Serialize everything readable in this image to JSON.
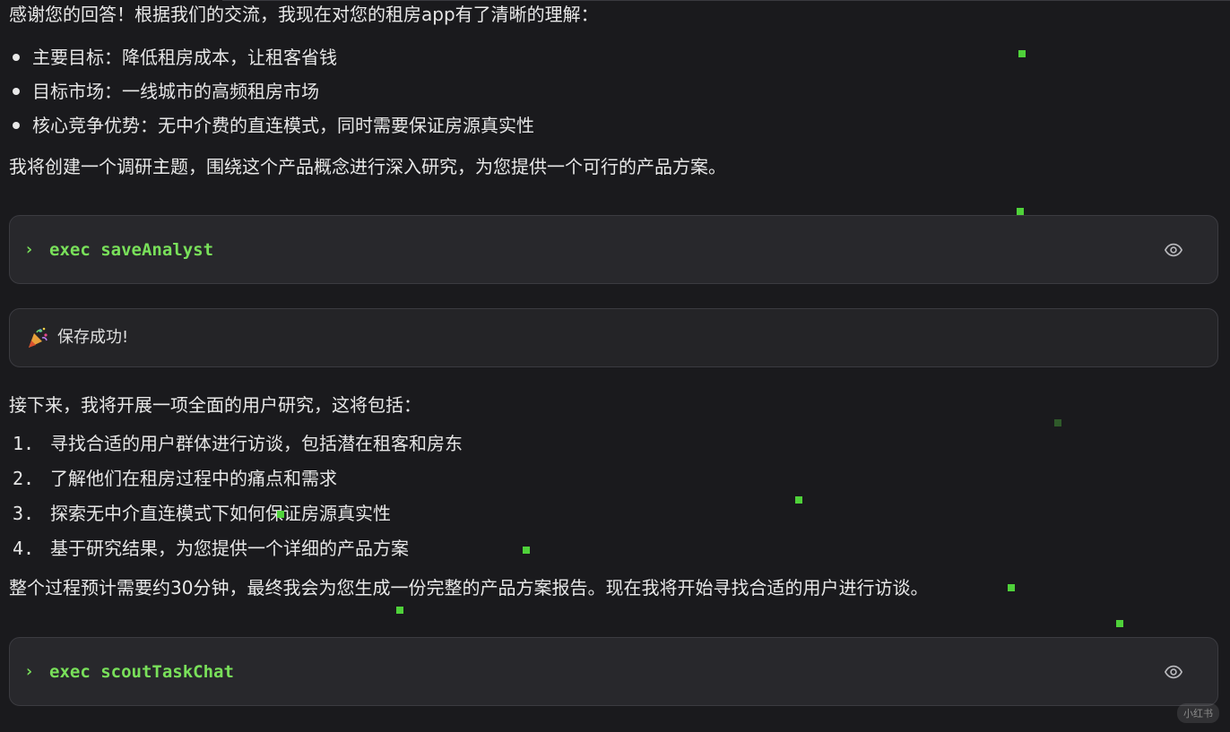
{
  "intro_text": "感谢您的回答！根据我们的交流，我现在对您的租房app有了清晰的理解：",
  "summary_points": [
    "主要目标：降低租房成本，让租客省钱",
    "目标市场：一线城市的高频租房市场",
    "核心竞争优势：无中介费的直连模式，同时需要保证房源真实性"
  ],
  "plan_text": "我将创建一个调研主题，围绕这个产品概念进行深入研究，为您提供一个可行的产品方案。",
  "tool_call_1": {
    "prompt": "›",
    "command": "exec saveAnalyst",
    "icon": "eye-icon"
  },
  "tool_result": {
    "icon": "party-popper-icon",
    "message": "保存成功!"
  },
  "next_text": "接下来，我将开展一项全面的用户研究，这将包括：",
  "research_steps": [
    {
      "num": "1.",
      "text": "寻找合适的用户群体进行访谈，包括潜在租客和房东"
    },
    {
      "num": "2.",
      "text": "了解他们在租房过程中的痛点和需求"
    },
    {
      "num": "3.",
      "text": "探索无中介直连模式下如何保证房源真实性"
    },
    {
      "num": "4.",
      "text": "基于研究结果，为您提供一个详细的产品方案"
    }
  ],
  "closing_text": "整个过程预计需要约30分钟，最终我会为您生成一份完整的产品方案报告。现在我将开始寻找合适的用户进行访谈。",
  "tool_call_2": {
    "prompt": "›",
    "command": "exec scoutTaskChat",
    "icon": "eye-icon"
  },
  "watermark": "小红书",
  "colors": {
    "background": "#1a1a1d",
    "command_green": "#79e05a",
    "box_bg": "#28282c",
    "text": "#e8e8e8"
  }
}
